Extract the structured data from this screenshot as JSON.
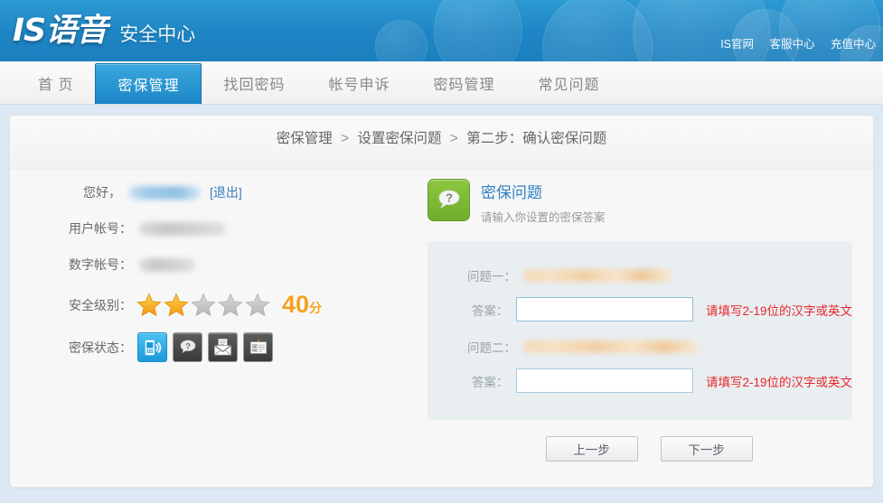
{
  "header": {
    "logo": "IS语音",
    "subtitle": "安全中心",
    "top_links": [
      {
        "label": "IS官网",
        "name": "is-official-site-link"
      },
      {
        "label": "客服中心",
        "name": "customer-service-link"
      },
      {
        "label": "充值中心",
        "name": "recharge-center-link"
      }
    ]
  },
  "nav": {
    "items": [
      {
        "label": "首 页",
        "active": false
      },
      {
        "label": "密保管理",
        "active": true
      },
      {
        "label": "找回密码",
        "active": false
      },
      {
        "label": "帐号申诉",
        "active": false
      },
      {
        "label": "密码管理",
        "active": false
      },
      {
        "label": "常见问题",
        "active": false
      }
    ]
  },
  "breadcrumb": {
    "item1": "密保管理",
    "sep1": ">",
    "item2": "设置密保问题",
    "sep2": ">",
    "item3": "第二步：确认密保问题"
  },
  "account": {
    "greeting_label": "您好，",
    "username_value": "",
    "logout_label": "[退出]",
    "user_account_label": "用户帐号：",
    "user_account_value": "",
    "digit_account_label": "数字帐号：",
    "digit_account_value": "",
    "security_level_label": "安全级别：",
    "score": "40",
    "score_unit": "分",
    "stars_total": 5,
    "stars_filled": 2,
    "security_status_label": "密保状态：",
    "status_icons": [
      {
        "name": "mobile-phone-icon",
        "active": true
      },
      {
        "name": "question-mark-icon",
        "active": false
      },
      {
        "name": "mail-envelope-icon",
        "active": false
      },
      {
        "name": "id-card-icon",
        "active": false
      }
    ]
  },
  "form": {
    "title": "密保问题",
    "subtitle": "请输入你设置的密保答案",
    "icon": "question-bubble-icon",
    "q1_label": "问题一：",
    "q1_value": "",
    "a1_label": "答案：",
    "a1_value": "",
    "a1_hint": "请填写2-19位的汉字或英文",
    "q2_label": "问题二：",
    "q2_value": "",
    "a2_label": "答案：",
    "a2_value": "",
    "a2_hint": "请填写2-19位的汉字或英文",
    "prev_button": "上一步",
    "next_button": "下一步"
  },
  "colors": {
    "header_blue": "#1e85c4",
    "accent_blue": "#2f7fc0",
    "active_tab": "#1b87c7",
    "error_red": "#e8272b",
    "score_orange": "#f5a21e",
    "green_icon": "#8dc63f",
    "form_bg": "#e9eef1"
  }
}
